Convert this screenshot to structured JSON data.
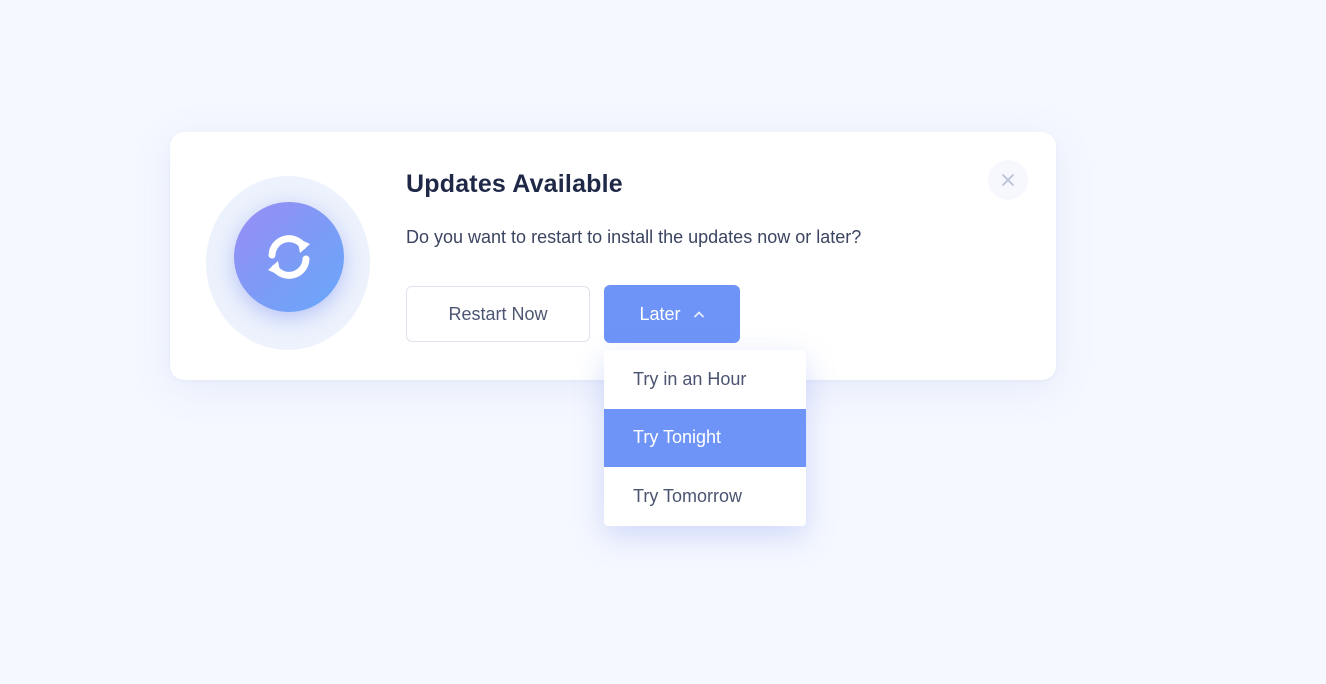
{
  "dialog": {
    "title": "Updates Available",
    "message": "Do you want to restart to install the updates now or later?",
    "icon": "refresh-icon",
    "close_icon": "close-icon"
  },
  "buttons": {
    "restart_label": "Restart Now",
    "later_label": "Later",
    "later_icon": "chevron-up-icon"
  },
  "dropdown": {
    "items": [
      {
        "label": "Try in an Hour",
        "active": false
      },
      {
        "label": "Try Tonight",
        "active": true
      },
      {
        "label": "Try Tomorrow",
        "active": false
      }
    ]
  },
  "colors": {
    "accent": "#6f94f8",
    "background": "#f5f8fe",
    "title": "#1f2947",
    "text": "#3b4461"
  }
}
